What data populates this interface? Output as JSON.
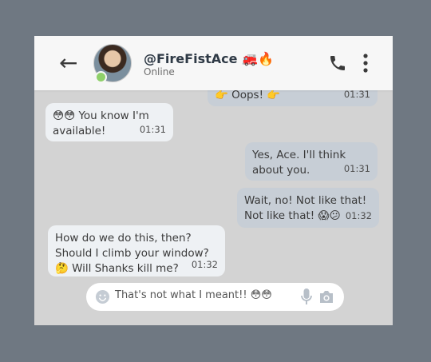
{
  "header": {
    "back_label": "←",
    "name": "@FireFistAce 🚒🔥",
    "status": "Online",
    "icons": [
      "back-arrow-icon",
      "phone-icon",
      "more-vert-icon"
    ]
  },
  "messages": [
    {
      "direction": "out",
      "text": "👉 Oops! 👉",
      "time": "01:31"
    },
    {
      "direction": "in",
      "text": "😳😳 You know I'm available!",
      "time": "01:31"
    },
    {
      "direction": "out",
      "text": "Yes, Ace. I'll think about you.",
      "time": "01:31"
    },
    {
      "direction": "out",
      "text": "Wait, no! Not like that! Not like that! 😱😕",
      "time": "01:32"
    },
    {
      "direction": "in",
      "text": "How do we do this, then? Should I climb your window? 🤔 Will Shanks kill me?",
      "time": "01:32"
    }
  ],
  "composer": {
    "draft": "That's not what I meant!! 😳😳",
    "icons": [
      "emoji-icon",
      "microphone-icon",
      "camera-icon"
    ]
  },
  "colors": {
    "background": "#6f7882",
    "chat_bg": "#d3d3d3",
    "incoming_bubble": "#eef1f4",
    "outgoing_bubble": "#c7ced6",
    "online": "#8fd06a"
  }
}
